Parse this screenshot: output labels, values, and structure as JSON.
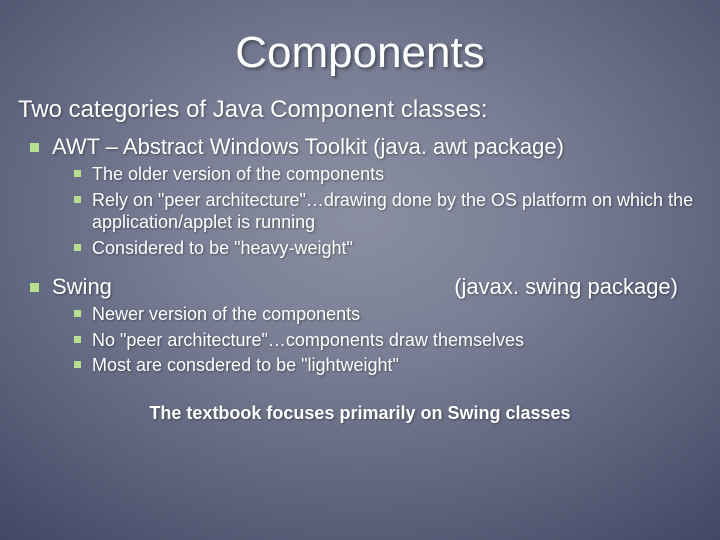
{
  "title": "Components",
  "intro": "Two categories of Java Component classes:",
  "awt": {
    "heading": "AWT – Abstract Windows Toolkit (java. awt package)",
    "points": [
      "The older version of the components",
      "Rely on \"peer architecture\"…drawing done by the OS platform on which the application/applet is running",
      "Considered to be \"heavy-weight\""
    ]
  },
  "swing": {
    "heading": "Swing",
    "pkg": "(javax. swing package)",
    "points": [
      "Newer version of the components",
      "No \"peer architecture\"…components draw themselves",
      "Most are consdered to be \"lightweight\""
    ]
  },
  "footnote": "The textbook focuses primarily on Swing classes"
}
